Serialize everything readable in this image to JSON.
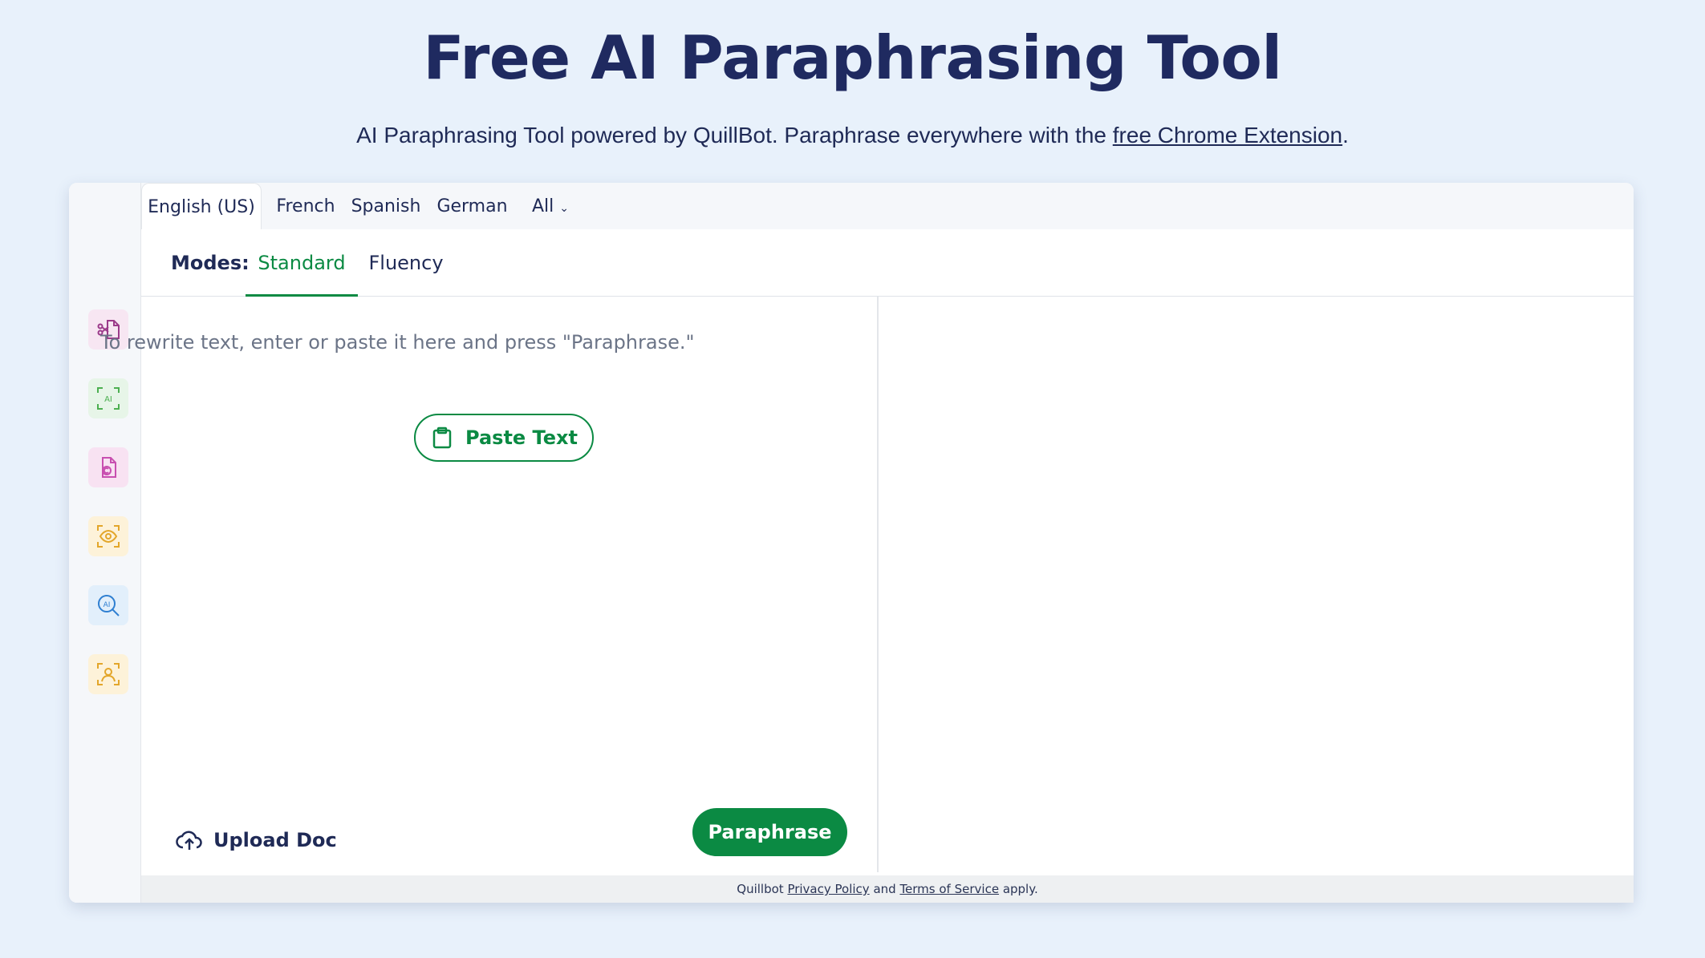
{
  "hero": {
    "title": "Free AI Paraphrasing Tool",
    "subtitle_prefix": "AI Paraphrasing Tool powered by QuillBot. Paraphrase everywhere with the ",
    "subtitle_link": "free Chrome Extension",
    "subtitle_suffix": "."
  },
  "languages": {
    "tabs": [
      "English (US)",
      "French",
      "Spanish",
      "German",
      "All"
    ],
    "active": "English (US)"
  },
  "modes": {
    "label": "Modes:",
    "tabs": [
      "Standard",
      "Fluency"
    ],
    "active": "Standard"
  },
  "editor": {
    "placeholder": "To rewrite text, enter or paste it here and press \"Paraphrase.\"",
    "paste_label": "Paste Text",
    "upload_label": "Upload Doc",
    "paraphrase_label": "Paraphrase"
  },
  "sidebar": {
    "tools": [
      {
        "icon": "summarize-doc-icon",
        "color": "#9b3a8a",
        "bg": "#f7e6f2"
      },
      {
        "icon": "ai-detector-icon",
        "color": "#4caf50",
        "bg": "#e7f5e8"
      },
      {
        "icon": "plagiarism-checker-icon",
        "color": "#c84fb0",
        "bg": "#f8e2f2"
      },
      {
        "icon": "eye-scan-icon",
        "color": "#e3a62a",
        "bg": "#fdf2d9"
      },
      {
        "icon": "ai-search-icon",
        "color": "#2f7fd1",
        "bg": "#e2effb"
      },
      {
        "icon": "humanizer-icon",
        "color": "#e3a62a",
        "bg": "#fdf2d9"
      }
    ]
  },
  "footer": {
    "prefix": "Quillbot ",
    "privacy": "Privacy Policy",
    "middle": " and ",
    "terms": "Terms of Service",
    "suffix": " apply."
  },
  "colors": {
    "accent": "#0b8a43",
    "heading": "#1f2a60",
    "background": "#e8f1fb"
  }
}
